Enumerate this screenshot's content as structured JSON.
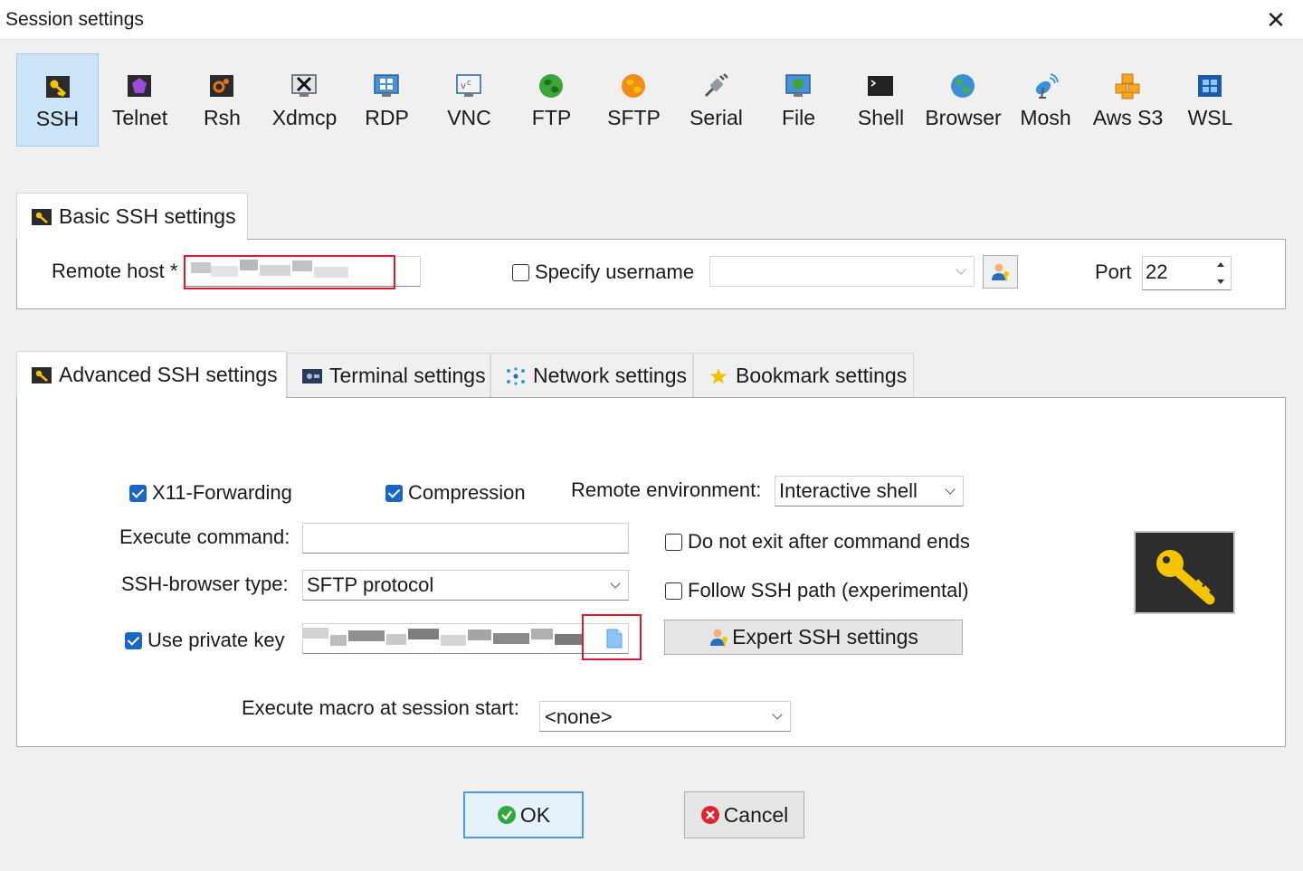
{
  "window": {
    "title": "Session settings",
    "close_glyph": "✕"
  },
  "protocols": [
    {
      "label": "SSH",
      "icon": "ssh-key-icon",
      "active": true
    },
    {
      "label": "Telnet",
      "icon": "telnet-icon"
    },
    {
      "label": "Rsh",
      "icon": "rsh-icon"
    },
    {
      "label": "Xdmcp",
      "icon": "xdmcp-icon"
    },
    {
      "label": "RDP",
      "icon": "rdp-icon"
    },
    {
      "label": "VNC",
      "icon": "vnc-icon"
    },
    {
      "label": "FTP",
      "icon": "ftp-globe-icon"
    },
    {
      "label": "SFTP",
      "icon": "sftp-globe-icon"
    },
    {
      "label": "Serial",
      "icon": "serial-plug-icon"
    },
    {
      "label": "File",
      "icon": "file-monitor-icon"
    },
    {
      "label": "Shell",
      "icon": "shell-terminal-icon"
    },
    {
      "label": "Browser",
      "icon": "browser-globe-icon"
    },
    {
      "label": "Mosh",
      "icon": "mosh-satellite-icon"
    },
    {
      "label": "Aws S3",
      "icon": "aws-s3-cubes-icon"
    },
    {
      "label": "WSL",
      "icon": "wsl-windows-icon"
    }
  ],
  "basic": {
    "tab_label": "Basic SSH settings",
    "remote_host_label": "Remote host *",
    "remote_host_value": "",
    "specify_username_label": "Specify username",
    "specify_username_checked": false,
    "username_value": "",
    "port_label": "Port",
    "port_value": "22"
  },
  "advanced_tabs": [
    {
      "label": "Advanced SSH settings",
      "icon": "key-icon",
      "active": true
    },
    {
      "label": "Terminal settings",
      "icon": "terminal-icon"
    },
    {
      "label": "Network settings",
      "icon": "network-icon"
    },
    {
      "label": "Bookmark settings",
      "icon": "star-icon"
    }
  ],
  "advanced": {
    "x11_label": "X11-Forwarding",
    "x11_checked": true,
    "compression_label": "Compression",
    "compression_checked": true,
    "remote_env_label": "Remote environment:",
    "remote_env_value": "Interactive shell",
    "execute_command_label": "Execute command:",
    "execute_command_value": "",
    "do_not_exit_label": "Do not exit after command ends",
    "do_not_exit_checked": false,
    "browser_type_label": "SSH-browser type:",
    "browser_type_value": "SFTP protocol",
    "follow_path_label": "Follow SSH path (experimental)",
    "follow_path_checked": false,
    "private_key_label": "Use private key",
    "private_key_checked": true,
    "expert_button_label": "Expert SSH settings",
    "macro_label": "Execute macro at session start:",
    "macro_value": "<none>"
  },
  "buttons": {
    "ok": "OK",
    "cancel": "Cancel"
  },
  "colors": {
    "accent": "#1a66c4",
    "selected_bg": "#cce4f7",
    "highlight_red": "#e0192b",
    "ok_green": "#2eaa3c",
    "cancel_red": "#e0232d"
  }
}
